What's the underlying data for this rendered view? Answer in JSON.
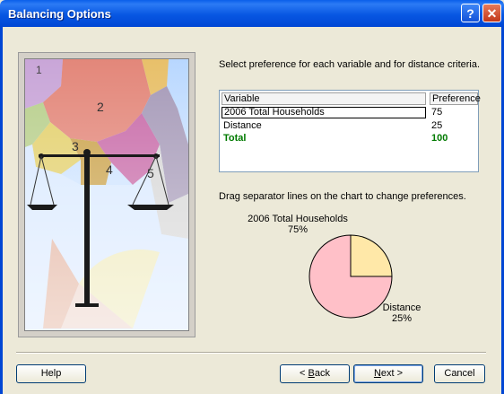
{
  "window": {
    "title": "Balancing Options"
  },
  "instruction": "Select preference for each variable and for distance criteria.",
  "table": {
    "headers": [
      "Variable",
      "Preference"
    ],
    "rows": [
      {
        "variable": "2006 Total Households",
        "preference": "75"
      },
      {
        "variable": "Distance",
        "preference": "25"
      },
      {
        "variable": "Total",
        "preference": "100"
      }
    ]
  },
  "drag_hint": "Drag separator lines on the chart to change preferences.",
  "image": {
    "region_labels": [
      "1",
      "2",
      "3",
      "4",
      "5"
    ]
  },
  "chart_data": {
    "type": "pie",
    "slices": [
      {
        "label": "2006 Total Households",
        "value": 75,
        "pct": "75%",
        "color": "#FFC0C8"
      },
      {
        "label": "Distance",
        "value": 25,
        "pct": "25%",
        "color": "#FFE8A8"
      }
    ]
  },
  "buttons": {
    "help": "Help",
    "back": {
      "prefix": "< ",
      "key": "B",
      "rest": "ack"
    },
    "next": {
      "key": "N",
      "rest": "ext >"
    },
    "cancel": "Cancel"
  }
}
